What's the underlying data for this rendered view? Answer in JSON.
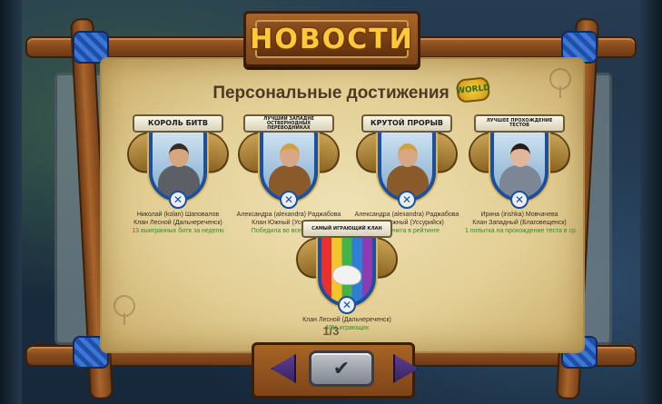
{
  "header": {
    "title": "НОВОСТИ",
    "subtitle": "Персональные достижения",
    "event_tag": "WORLD"
  },
  "achievements": [
    {
      "ribbon": "КОРОЛЬ БИТВ",
      "name": "Николай (kolan) Шаповалов",
      "clan": "Клан Лесной (Дальнереченск)",
      "stat": "13 выигранных битв за неделю"
    },
    {
      "ribbon": "ЛУЧШИЙ ЗАПАДНЕ ОСТВЕРНОДНЫХ ПЕРЕВОДНИКАХ",
      "name": "Александра (alexandra) Раджабова",
      "clan": "Клан Южный (Уссурийск)",
      "stat": "Победила во всех битвах"
    },
    {
      "ribbon": "КРУТОЙ ПРОРЫВ",
      "name": "Александра (alexandra) Раджабова",
      "clan": "Клан Южный (Уссурийск)",
      "stat": "+34 пункта в рейтинге"
    },
    {
      "ribbon": "ЛУЧШЕЕ ПРОХОЖДЕНИЕ ТЕСТОВ",
      "name": "Ирина (irishka) Мовчачева",
      "clan": "Клан Западный (Благовещенск)",
      "stat": "1 попытка на прохождение теста в ср"
    }
  ],
  "clan_achievement": {
    "ribbon": "САМЫЙ ИГРАЮЩИЙ КЛАН",
    "clan": "Клан Лесной (Дальнереченск)",
    "stat": "40% играющих"
  },
  "pagination": {
    "text": "1/3"
  },
  "controls": {
    "prev_icon": "arrow-left-icon",
    "next_icon": "arrow-right-icon",
    "ok_icon": "checkmark-icon"
  },
  "colors": {
    "title_gold": "#ffc93a",
    "stat_green": "#2f8d2a",
    "shield_blue": "#1c4f9c",
    "parchment": "#e3cf95",
    "wood": "#8a4d1e"
  }
}
